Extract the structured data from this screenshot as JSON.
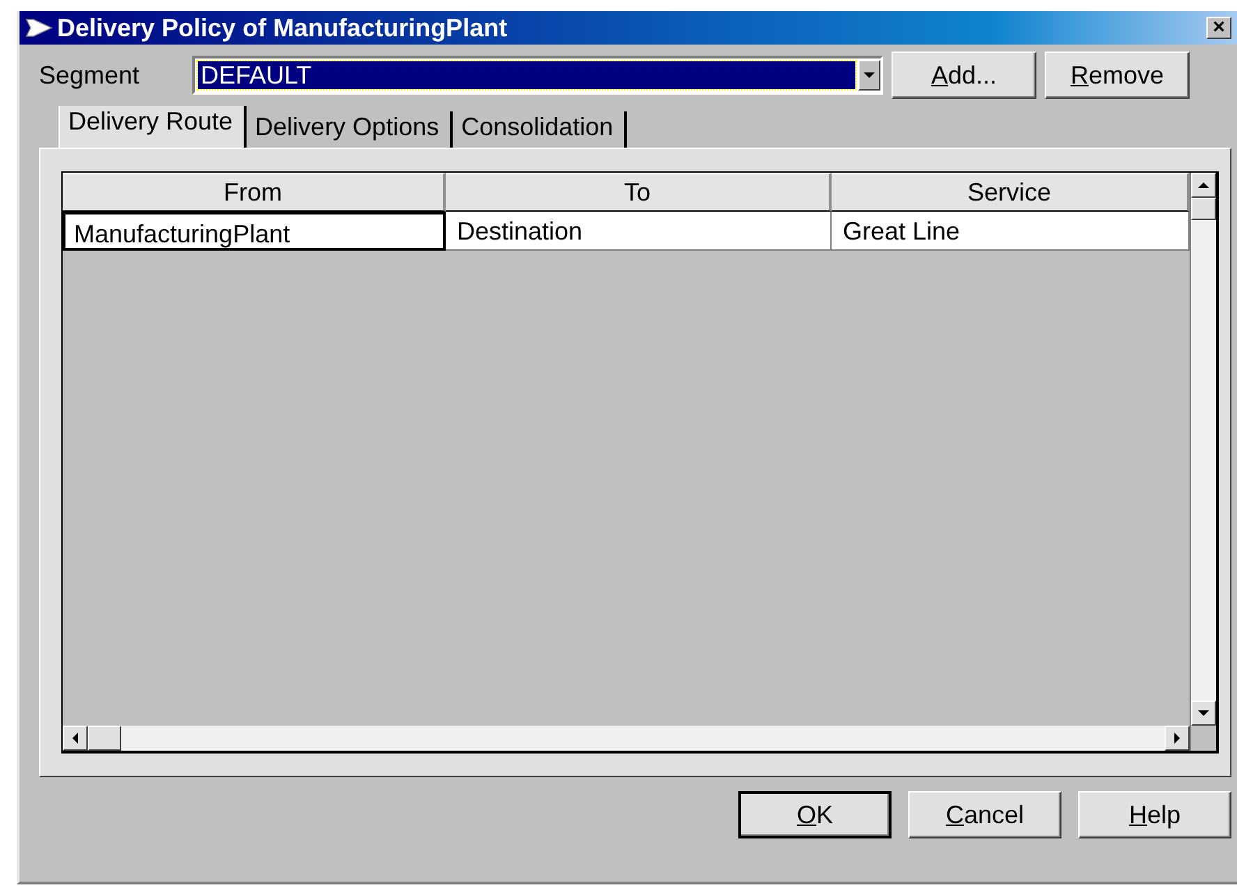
{
  "window": {
    "title": "Delivery Policy of ManufacturingPlant",
    "close": "×"
  },
  "segment": {
    "label": "Segment",
    "value": "DEFAULT"
  },
  "segment_buttons": [
    {
      "label": "Add...",
      "mnemonic": true
    },
    {
      "label": "Remove",
      "mnemonic": true
    }
  ],
  "tabs": [
    {
      "label": "Delivery Route",
      "selected": true
    },
    {
      "label": "Delivery Options",
      "selected": false
    },
    {
      "label": "Consolidation",
      "selected": false
    }
  ],
  "table": {
    "columns": [
      "From",
      "To",
      "Service"
    ],
    "rows": [
      {
        "cells": [
          {
            "text": "ManufacturingPlant",
            "focused": true
          },
          {
            "text": "Destination",
            "focused": false
          },
          {
            "text": "Great Line",
            "focused": false
          }
        ]
      }
    ]
  },
  "buttons": [
    {
      "label": "OK",
      "mnemonic": true,
      "default": true
    },
    {
      "label": "Cancel",
      "mnemonic": true,
      "default": false
    },
    {
      "label": "Help",
      "mnemonic": true,
      "default": false
    }
  ]
}
